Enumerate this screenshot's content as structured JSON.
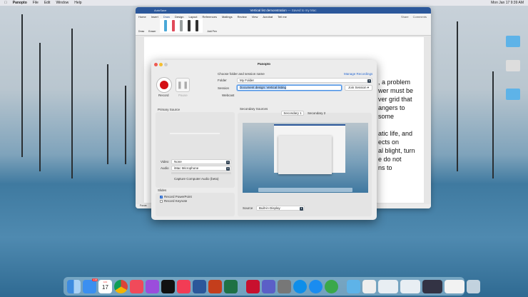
{
  "menubar": {
    "app": "Panopto",
    "items": [
      "File",
      "Edit",
      "Window",
      "Help"
    ],
    "clock": "Mon Jan 17  9:39 AM"
  },
  "word": {
    "title": "Vertical list demonstration",
    "title_suffix": "— Saved to my Mac",
    "autosave": "AutoSave",
    "tabs": [
      "Home",
      "Insert",
      "Draw",
      "Design",
      "Layout",
      "References",
      "Mailings",
      "Review",
      "View",
      "Acrobat",
      "Tell me"
    ],
    "active_tab": "Draw",
    "share": "Share",
    "comments": "Comments",
    "draw_label": "Draw",
    "eraser_label": "Eraser",
    "add_pen": "Add Pen",
    "pen_colors": [
      "#4aa8d8",
      "#e04a5a",
      "#9aa0a0",
      "#333333",
      "#333333"
    ],
    "doc_lines": [
      ", a problem",
      "wer must be",
      "ver grid that",
      "angers to",
      "some",
      "",
      "atic life, and",
      "ects on",
      "al blight, turn",
      "e do not",
      "ns to"
    ],
    "status": "Focus"
  },
  "panopto": {
    "title": "Panopto",
    "record": "Record",
    "pause": "Pause",
    "choose_label": "Choose folder and session name",
    "manage": "Manage Recordings",
    "folder_label": "Folder",
    "folder_value": "My Folder",
    "session_label": "Session",
    "session_value": "Document design: Vertical listing",
    "join": "Join Session",
    "webcast": "Webcast",
    "primary": {
      "heading": "Primary Source",
      "video_label": "Video",
      "video_value": "None",
      "audio_label": "Audio",
      "audio_value": "iMac Microphone",
      "capture": "Capture Computer Audio (beta)"
    },
    "slides": {
      "heading": "Slides",
      "items": [
        {
          "label": "Record PowerPoint",
          "checked": true
        },
        {
          "label": "Record Keynote",
          "checked": false
        }
      ]
    },
    "secondary": {
      "heading": "Secondary Sources",
      "tabs": [
        "Secondary 1",
        "Secondary 2"
      ],
      "source_label": "Source",
      "source_value": "Built-in Display"
    }
  },
  "dock": {
    "mail_badge": "115",
    "calendar_day": "17",
    "calendar_month": "JAN"
  }
}
